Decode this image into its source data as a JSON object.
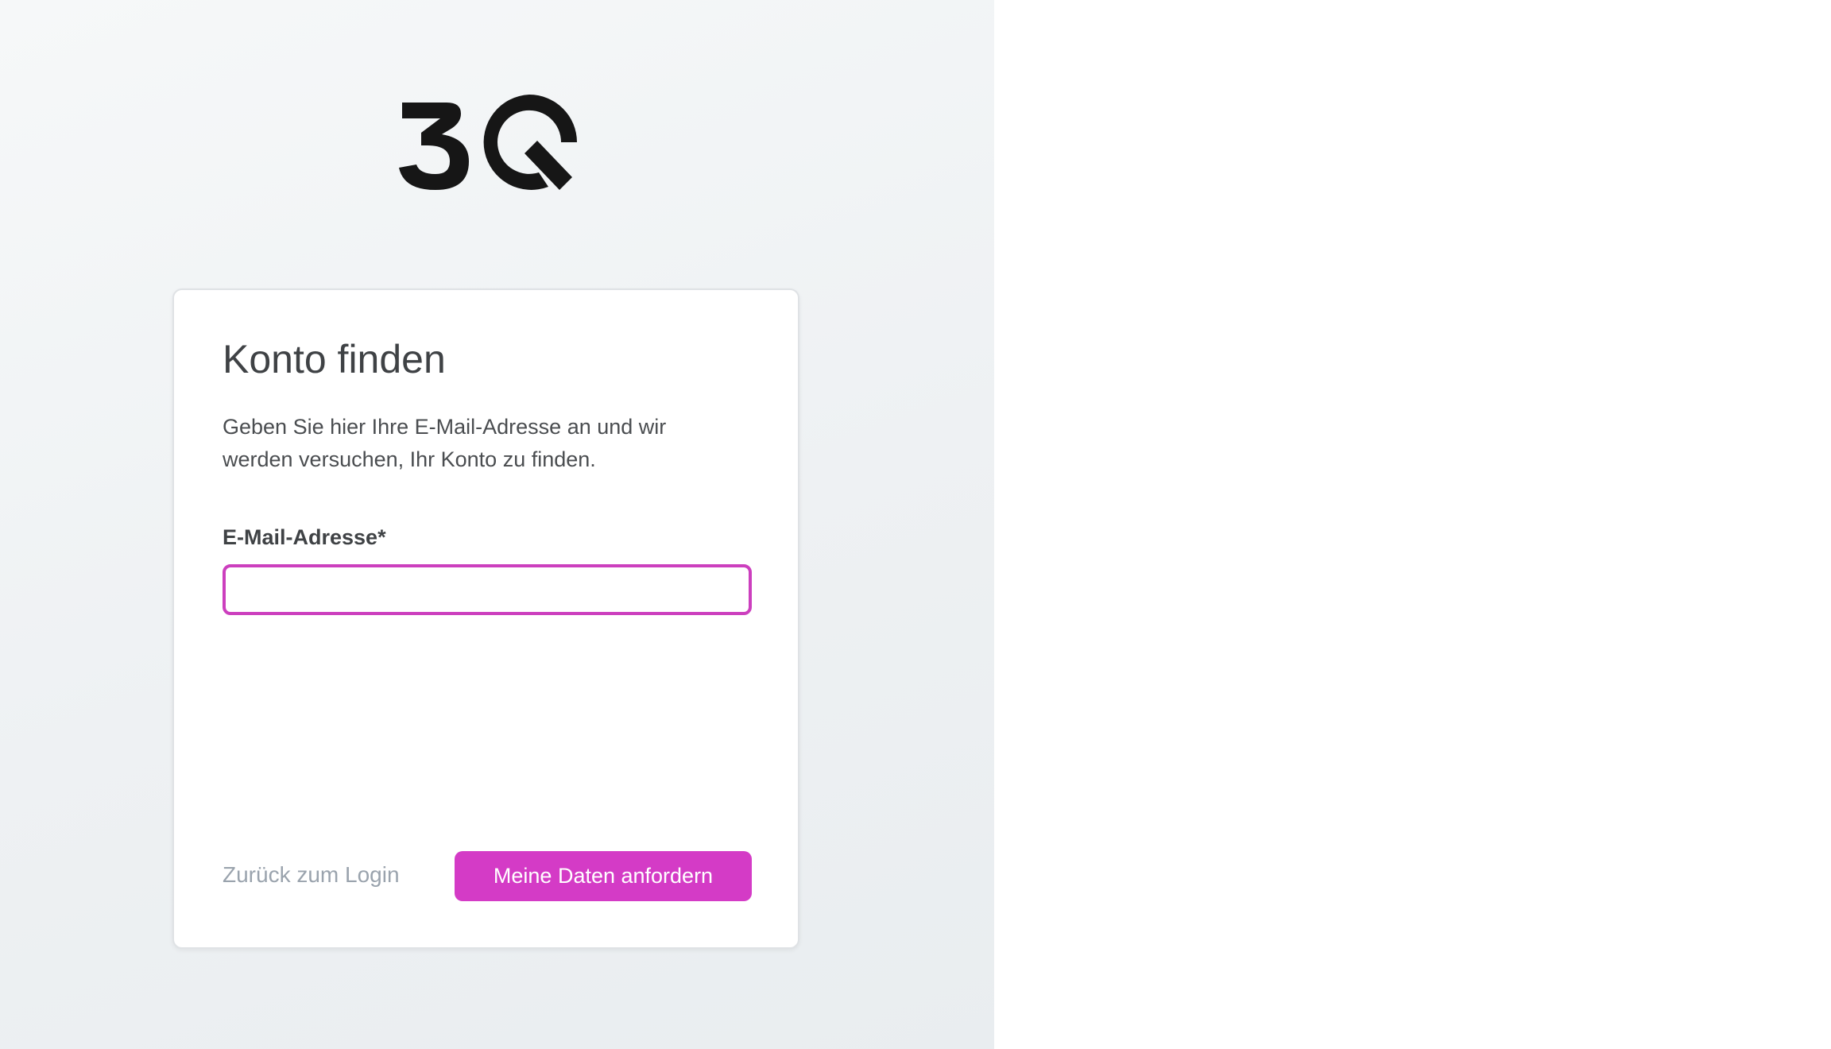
{
  "brand": {
    "logo_text": "3Q",
    "logo_color": "#161616"
  },
  "card": {
    "title": "Konto finden",
    "description": "Geben Sie hier Ihre E-Mail-Adresse an und wir werden versuchen, Ihr Konto zu finden.",
    "email_label": "E-Mail-Adresse*",
    "email_value": "",
    "email_placeholder": "",
    "back_link_label": "Zurück zum Login",
    "submit_label": "Meine Daten anfordern"
  },
  "colors": {
    "accent": "#d43bc6",
    "input_focus_border": "#cc3fbe",
    "muted_link": "#9aa3ad",
    "left_background": "#eef1f3"
  }
}
